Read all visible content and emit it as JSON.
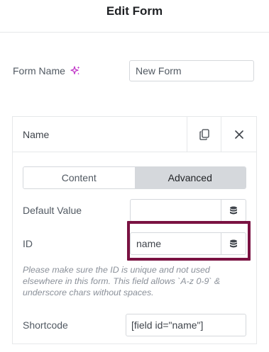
{
  "header": {
    "title": "Edit Form"
  },
  "form_name": {
    "label": "Form Name",
    "value": "New Form",
    "ai_icon": "sparkle-icon"
  },
  "field_panel": {
    "name": "Name",
    "copy_icon": "copy-icon",
    "close_icon": "close-icon",
    "tabs": [
      {
        "label": "Content",
        "active": false
      },
      {
        "label": "Advanced",
        "active": true
      }
    ],
    "default_value": {
      "label": "Default Value",
      "value": "",
      "dynamic_icon": "database-icon"
    },
    "id": {
      "label": "ID",
      "value": "name",
      "dynamic_icon": "database-icon"
    },
    "help_text": "Please make sure the ID is unique and not used elsewhere in this form. This field allows `A-z 0-9` & underscore chars without spaces.",
    "shortcode": {
      "label": "Shortcode",
      "value": "[field id=\"name\"]"
    }
  },
  "colors": {
    "highlight_border": "#7a1242",
    "sparkle": "#c034c7",
    "active_tab_bg": "#d5d8dc"
  }
}
